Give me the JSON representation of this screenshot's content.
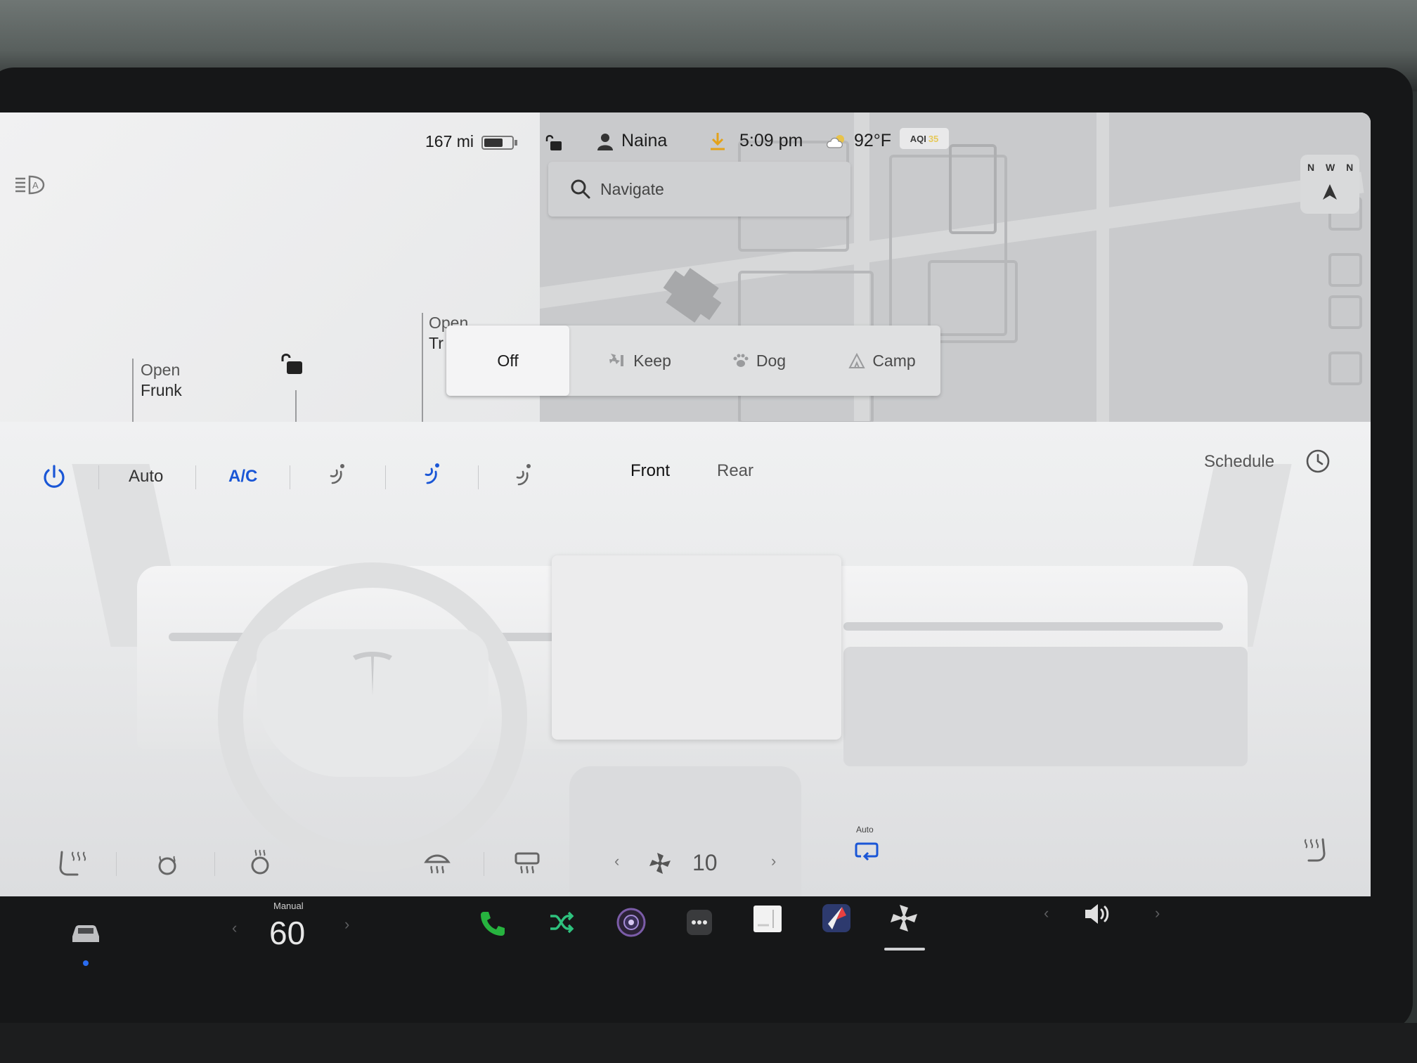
{
  "status": {
    "range": "167 mi",
    "battery_level": 0.45,
    "driver": "Naina",
    "time": "5:09 pm",
    "temperature": "92°F",
    "aqi_label": "AQI",
    "aqi_value": "35"
  },
  "navigation": {
    "search_placeholder": "Navigate",
    "compass_letters": "N W N"
  },
  "vehicle": {
    "frunk_line1": "Open",
    "frunk_line2": "Frunk",
    "trunk_line1": "Open",
    "trunk_line2": "Tr"
  },
  "cabin_modes": [
    {
      "label": "Off",
      "selected": true
    },
    {
      "label": "Keep",
      "selected": false
    },
    {
      "label": "Dog",
      "selected": false
    },
    {
      "label": "Camp",
      "selected": false
    }
  ],
  "climate": {
    "auto_label": "Auto",
    "ac_label": "A/C",
    "front_label": "Front",
    "rear_label": "Rear",
    "schedule_label": "Schedule",
    "fan_speed": "10",
    "recirc_label": "Auto"
  },
  "taskbar": {
    "speed_label": "Manual",
    "speed_value": "60"
  },
  "colors": {
    "accent_blue": "#1a56d6",
    "phone_green": "#27b33f",
    "shuffle_green": "#2ec27e"
  }
}
